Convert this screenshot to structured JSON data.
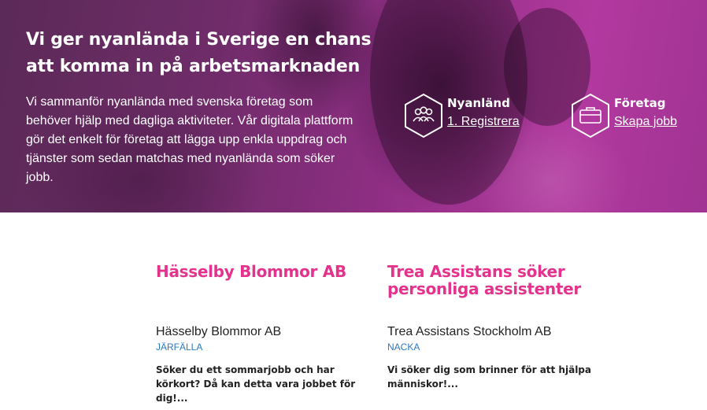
{
  "hero": {
    "title": "Vi ger nyanlända i Sverige en chans att komma in på arbetsmarknaden",
    "description": "Vi sammanför nyanlända med svenska företag som behöver hjälp med dagliga aktiviteter. Vår digitala plattform gör det enkelt för företag att lägga upp enkla uppdrag och tjänster som sedan matchas med nyanlända som söker jobb.",
    "overlay_color": "#b2399f"
  },
  "ctas": [
    {
      "title": "Nyanländ",
      "link": "1. Registrera",
      "icon": "people-icon"
    },
    {
      "title": "Företag",
      "link": "Skapa jobb",
      "icon": "briefcase-icon"
    }
  ],
  "jobs": [
    {
      "title": "Hässelby Blommor AB",
      "company": "Hässelby Blommor AB",
      "location": "JÄRFÄLLA",
      "description": "Söker du ett sommarjobb och har körkort? Då kan detta vara jobbet för dig!..."
    },
    {
      "title": "Trea Assistans söker personliga assistenter",
      "company": "Trea Assistans Stockholm AB",
      "location": "NACKA",
      "description": "Vi söker dig som brinner för att hjälpa människor!..."
    }
  ],
  "colors": {
    "accent": "#e4338c",
    "location": "#2a7ac4"
  }
}
